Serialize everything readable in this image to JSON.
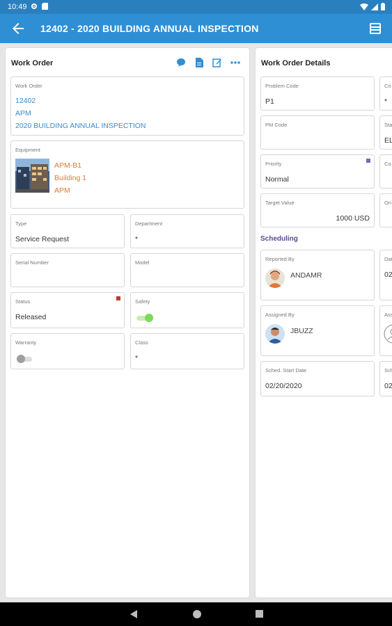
{
  "status_bar": {
    "time": "10:49"
  },
  "app_bar": {
    "title": "12402 - 2020 BUILDING ANNUAL INSPECTION"
  },
  "left_panel": {
    "title": "Work Order",
    "work_order": {
      "label": "Work Order",
      "number": "12402",
      "org": "APM",
      "description": "2020 BUILDING ANNUAL INSPECTION"
    },
    "equipment": {
      "label": "Equipment",
      "code": "APM-B1",
      "name": "Building 1",
      "org": "APM"
    },
    "type": {
      "label": "Type",
      "value": "Service Request"
    },
    "department": {
      "label": "Department",
      "value": "*"
    },
    "serial_number": {
      "label": "Serial Number",
      "value": ""
    },
    "model": {
      "label": "Model",
      "value": ""
    },
    "status": {
      "label": "Status",
      "value": "Released",
      "indicator_color": "#c0392b"
    },
    "safety": {
      "label": "Safety",
      "on": true
    },
    "warranty": {
      "label": "Warranty",
      "on": false
    },
    "class": {
      "label": "Class",
      "value": "*"
    }
  },
  "right_panel": {
    "title": "Work Order Details",
    "problem_code": {
      "label": "Problem Code",
      "value": "P1"
    },
    "criticality": {
      "label": "Cri",
      "value": "*"
    },
    "pm_code": {
      "label": "PM Code",
      "value": ""
    },
    "status2": {
      "label": "Sta",
      "value": "EL"
    },
    "priority": {
      "label": "Priority",
      "value": "Normal",
      "indicator_color": "#7b68b5"
    },
    "cost_code": {
      "label": "Co",
      "value": ""
    },
    "target_value": {
      "label": "Target Value",
      "value": "1000 USD"
    },
    "original": {
      "label": "Ori",
      "value": ""
    },
    "scheduling_title": "Scheduling",
    "reported_by": {
      "label": "Reported By",
      "value": "ANDAMR"
    },
    "date_reported": {
      "label": "Dat",
      "value": "02"
    },
    "assigned_by": {
      "label": "Assigned By",
      "value": "JBUZZ"
    },
    "assigned_to": {
      "label": "Ass",
      "value": ""
    },
    "sched_start": {
      "label": "Sched. Start Date",
      "value": "02/20/2020"
    },
    "sched_end": {
      "label": "Sch",
      "value": "02"
    }
  },
  "colors": {
    "app_bar": "#2f8fd5",
    "status_bar": "#2a7fbf",
    "link": "#3b8ad0",
    "equipment": "#e07a2f",
    "toggle_on": "#7ed957",
    "toggle_off": "#9e9e9e"
  }
}
